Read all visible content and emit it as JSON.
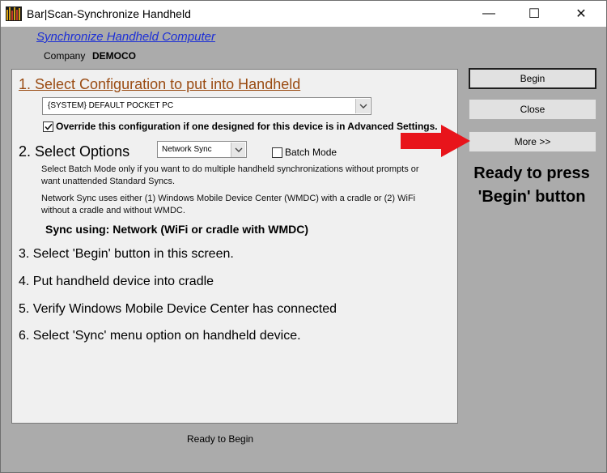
{
  "window": {
    "title": "Bar|Scan-Synchronize Handheld",
    "minimize_glyph": "—",
    "maximize_glyph": "☐",
    "close_glyph": "✕"
  },
  "header": {
    "link_text": "Synchronize Handheld Computer",
    "company_label": "Company",
    "company_value": "DEMOCO"
  },
  "step1": {
    "title": "1. Select Configuration to put into Handheld",
    "config_selected": "{SYSTEM} DEFAULT POCKET PC",
    "override_checked": true,
    "override_label": "Override this configuration if one designed  for this device is in Advanced Settings."
  },
  "step2": {
    "title": "2. Select Options",
    "option_selected": "Network Sync",
    "batch_label": "Batch Mode",
    "batch_checked": false,
    "help_batch": "Select Batch Mode only if you want to do multiple handheld synchronizations without prompts or want unattended Standard Syncs.",
    "help_network": "Network Sync uses either (1) Windows Mobile Device Center (WMDC)  with a cradle or (2) WiFi without a cradle and without WMDC.",
    "sync_using": "Sync using: Network (WiFi or cradle with WMDC)"
  },
  "steps": {
    "step3": "3. Select 'Begin' button in this screen.",
    "step4": "4. Put handheld device into cradle",
    "step5": "5. Verify Windows Mobile Device Center has connected",
    "step6": "6. Select 'Sync' menu option on handheld device."
  },
  "buttons": {
    "begin": "Begin",
    "close": "Close",
    "more": "More >>"
  },
  "annotation": {
    "ready_note": "Ready to press 'Begin' button",
    "arrow_color": "#e8141b"
  },
  "status": {
    "text": "Ready to Begin"
  },
  "icons": [
    "app-icon",
    "chevron-down-icon",
    "checkmark-icon",
    "red-arrow-icon"
  ]
}
